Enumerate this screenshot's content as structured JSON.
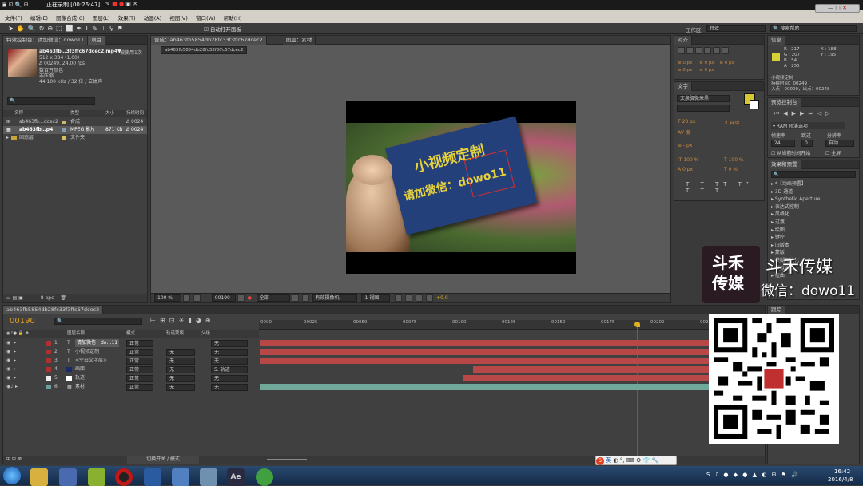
{
  "title_bar": {
    "status": "正在录制 [00:26:47]"
  },
  "menu": [
    "文件(F)",
    "编辑(E)",
    "图像合成(C)",
    "图层(L)",
    "效果(T)",
    "动画(A)",
    "视图(V)",
    "窗口(W)",
    "帮助(H)"
  ],
  "toolbar": {
    "auto_open": "自动打开面板",
    "workspace_label": "工作区:",
    "workspace_value": "特效",
    "search_placeholder": "搜索帮助"
  },
  "project": {
    "tab": "特效控制台：请加微信：dowo11",
    "tab2": "项目",
    "file_name": "ab463fb…3f3ffc67dcec2.mp4▼",
    "used": "被使用1次",
    "line1": "512 x 384 (1.00)",
    "line2": "Δ 00249, 24.00 fps",
    "line3": "数百万颜色",
    "line4": "非压缩",
    "line5": "44.100 kHz / 32 位 / 立体声",
    "col_name": "名称",
    "col_type": "类型",
    "col_size": "大小",
    "col_dur": "持续时间",
    "items": [
      {
        "name": "ab463fb…dcec2",
        "type": "合成",
        "size": "",
        "dur": "Δ 0024"
      },
      {
        "name": "ab463fb…p4",
        "type": "MPEG 影片",
        "size": "871 KB",
        "dur": "Δ 0024"
      },
      {
        "name": "固态层",
        "type": "文件夹",
        "size": "",
        "dur": ""
      }
    ],
    "bpc": "8 bpc"
  },
  "comp": {
    "tab": "合成：ab463fb5854db28fc33f3ffc67dcec2",
    "tab2": "图层：素材",
    "breadcrumb": "ab463fb5854db28fc33f3ffc67dcec2",
    "card_line1": "小视频定制",
    "card_line2": "请加微信：dowo11",
    "zoom": "100 %",
    "time": "00190",
    "res": "全部",
    "camera": "有效摄像机",
    "view": "1 视图",
    "offset": "+0.0"
  },
  "align": {
    "tab": "对齐"
  },
  "text_panel": {
    "tab": "文字",
    "font": "文泉驿微米黑",
    "size": "28 px",
    "leading": "自动",
    "tracking": "度",
    "px": "px",
    "scale_v": "100 %",
    "scale_h": "100 %",
    "baseline": "0 px",
    "tsume": "0 %"
  },
  "info": {
    "tab": "信息",
    "r": "R : 217",
    "g": "G : 207",
    "b": "B : 54",
    "a": "A : 255",
    "x": "X : 188",
    "y": "Y : 195",
    "layer_name": "小视频定制",
    "dur": "持续时间：00249",
    "in_out": "入点：00000，出点：00248"
  },
  "preview": {
    "tab": "预览控制台",
    "ram": "RAM 预演选项",
    "fps_label": "帧速率",
    "skip_label": "跳过",
    "res_label": "分辨率",
    "fps": "24",
    "skip": "0",
    "res": "自动",
    "from_current": "从当前时间开始",
    "full": "全屏"
  },
  "effects": {
    "tab": "效果和预置",
    "items": [
      "*【动画预置】",
      "3D 通道",
      "Synthetic Aperture",
      "表达式控制",
      "风格化",
      "过渡",
      "绘图",
      "键控",
      "旧版本",
      "蒙版",
      "模糊与锐化",
      "模拟仿真",
      "扭曲"
    ]
  },
  "timeline": {
    "tab": "ab463fb5854db28fc33f3ffc67dcec2",
    "timecode": "00190",
    "col_src": "图层名称",
    "col_mode": "模式",
    "col_trk": "轨道蒙版",
    "col_parent": "父级",
    "ticks": [
      "0000",
      "00025",
      "00050",
      "00075",
      "00100",
      "00125",
      "00150",
      "00175",
      "00200",
      "00225"
    ],
    "layers": [
      {
        "n": "1",
        "name": "请加微信：do…11",
        "mode": "正常",
        "trk": "",
        "parent": "无",
        "color": "#b03030"
      },
      {
        "n": "2",
        "name": "小视频定制",
        "mode": "正常",
        "trk": "无",
        "parent": "无",
        "color": "#b03030"
      },
      {
        "n": "3",
        "name": "<空白文字层>",
        "mode": "正常",
        "trk": "无",
        "parent": "无",
        "color": "#b03030"
      },
      {
        "n": "4",
        "name": "画面",
        "mode": "正常",
        "trk": "无",
        "parent": "5. 轨迹",
        "color": "#b03030"
      },
      {
        "n": "5",
        "name": "轨迹",
        "mode": "正常",
        "trk": "无",
        "parent": "无",
        "color": "#eeeeee"
      },
      {
        "n": "6",
        "name": "素材",
        "mode": "正常",
        "trk": "无",
        "parent": "无",
        "color": "#6aa0a0"
      }
    ],
    "switch_label": "切换开关 / 模式"
  },
  "watermark": {
    "logo_text": "斗禾\n传媒",
    "brand": "斗禾传媒",
    "wechat": "微信：dowo11"
  },
  "tracker": {
    "tab": "跟踪"
  },
  "taskbar": {
    "time": "16:42",
    "date": "2016/4/8",
    "ime": "英"
  }
}
